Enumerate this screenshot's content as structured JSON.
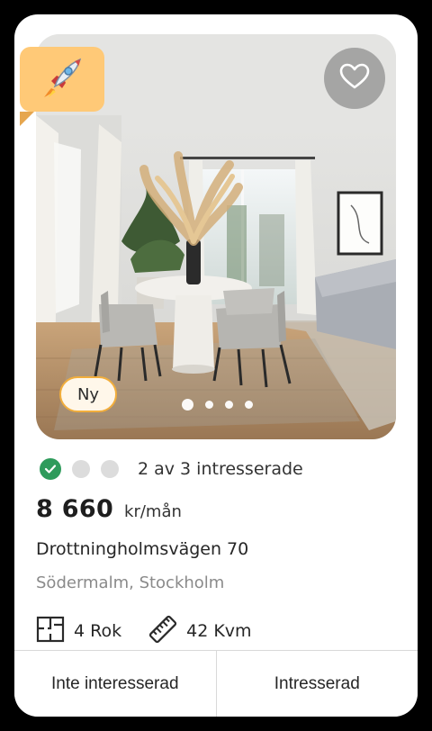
{
  "listing": {
    "badge_new": "Ny",
    "image_count": 4,
    "active_image_index": 0,
    "promo_icon": "rocket-icon",
    "favorite_icon": "heart-icon",
    "interest": {
      "text": "2 av 3 intresserade",
      "confirmed_count": 1,
      "total": 3
    },
    "price": {
      "value": "8 660",
      "unit": "kr/mån"
    },
    "address": "Drottningholmsvägen 70",
    "area": "Södermalm, Stockholm",
    "facts": {
      "rooms": "4 Rok",
      "size": "42 Kvm",
      "rooms_icon": "floorplan-icon",
      "size_icon": "ruler-icon"
    },
    "actions": {
      "decline": "Inte interesserad",
      "accept": "Intresserad"
    }
  },
  "colors": {
    "promo_badge": "#ffc977",
    "new_badge_border": "#f2ae3c",
    "check_green": "#2e9b5b"
  }
}
